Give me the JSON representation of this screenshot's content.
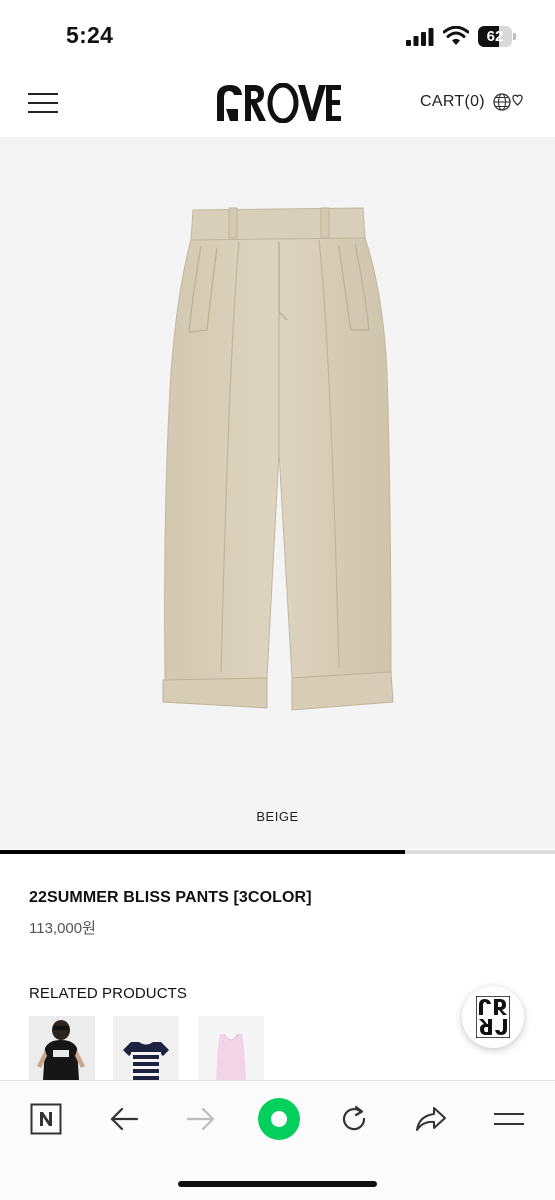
{
  "status_bar": {
    "time": "5:24",
    "battery_level": "62",
    "icons": [
      "signal-icon",
      "wifi-icon",
      "battery-icon"
    ]
  },
  "header": {
    "brand": "GROVE",
    "cart_label": "CART(0)",
    "icons": [
      "hamburger-menu-icon",
      "globe-heart-icon"
    ]
  },
  "product": {
    "color_caption": "BEIGE",
    "image_progress": 0.73,
    "name": "22SUMMER BLISS PANTS [3COLOR]",
    "price": "113,000원"
  },
  "related": {
    "title": "RELATED PRODUCTS",
    "items": [
      {
        "name": "black-graphic-tee"
      },
      {
        "name": "navy-striped-top"
      },
      {
        "name": "pink-tank-top"
      }
    ]
  },
  "toolbar": {
    "icons": [
      "naver-n-icon",
      "back-arrow-icon",
      "forward-arrow-icon",
      "green-dot-icon",
      "refresh-icon",
      "share-icon",
      "menu-icon"
    ]
  },
  "colors": {
    "image_bg": "#f4f4f4",
    "pants_beige": "#d6ccb6",
    "accent_green": "#03cf5d",
    "progress_active": "#000000"
  }
}
